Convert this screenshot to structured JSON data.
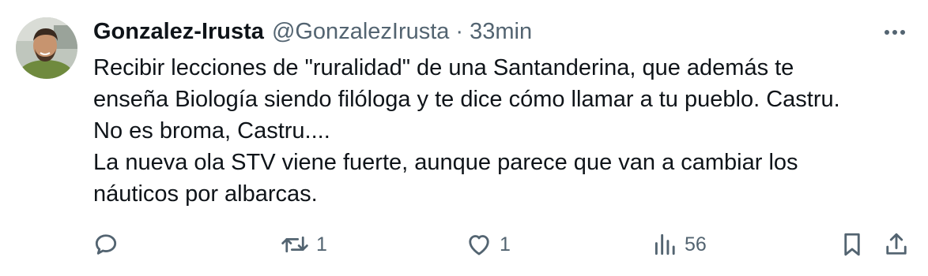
{
  "author": {
    "display_name": "Gonzalez-Irusta",
    "handle": "@GonzalezIrusta",
    "separator": "·",
    "timestamp": "33min"
  },
  "tweet": {
    "lines": [
      "Recibir lecciones de \"ruralidad\" de una Santanderina, que además te",
      "enseña Biología siendo filóloga y te dice cómo llamar a tu pueblo. Castru.",
      "No es broma, Castru....",
      "La nueva ola STV viene fuerte, aunque parece que van a cambiar los",
      "náuticos por albarcas."
    ]
  },
  "actions": {
    "reply": {
      "icon": "reply-icon",
      "count": ""
    },
    "retweet": {
      "icon": "retweet-icon",
      "count": "1"
    },
    "like": {
      "icon": "heart-icon",
      "count": "1"
    },
    "views": {
      "icon": "views-icon",
      "count": "56"
    },
    "bookmark": {
      "icon": "bookmark-icon"
    },
    "share": {
      "icon": "share-icon"
    }
  },
  "colors": {
    "text": "#0f1419",
    "secondary": "#536471",
    "background": "#ffffff"
  }
}
